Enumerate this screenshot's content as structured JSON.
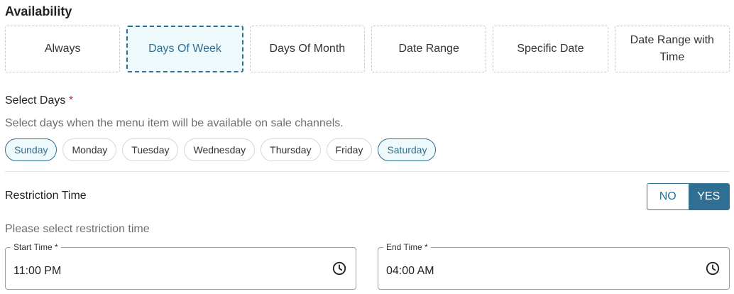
{
  "availability": {
    "title": "Availability",
    "options": [
      {
        "label": "Always",
        "active": false
      },
      {
        "label": "Days Of Week",
        "active": true
      },
      {
        "label": "Days Of Month",
        "active": false
      },
      {
        "label": "Date Range",
        "active": false
      },
      {
        "label": "Specific Date",
        "active": false
      },
      {
        "label": "Date Range with Time",
        "active": false
      }
    ]
  },
  "select_days": {
    "label": "Select Days",
    "required_mark": "*",
    "help": "Select days when the menu item will be available on sale channels.",
    "days": [
      {
        "label": "Sunday",
        "selected": true
      },
      {
        "label": "Monday",
        "selected": false
      },
      {
        "label": "Tuesday",
        "selected": false
      },
      {
        "label": "Wednesday",
        "selected": false
      },
      {
        "label": "Thursday",
        "selected": false
      },
      {
        "label": "Friday",
        "selected": false
      },
      {
        "label": "Saturday",
        "selected": true
      }
    ]
  },
  "restriction": {
    "label": "Restriction Time",
    "toggle_no": "NO",
    "toggle_yes": "YES",
    "selected": "YES",
    "help": "Please select restriction time",
    "start_time": {
      "label": "Start Time *",
      "value": "11:00 PM",
      "icon": "clock-icon"
    },
    "end_time": {
      "label": "End Time *",
      "value": "04:00 AM",
      "icon": "clock-icon"
    }
  },
  "colors": {
    "accent": "#2e6f93",
    "selected_bg": "#eef9fb",
    "required": "#d32f2f"
  }
}
